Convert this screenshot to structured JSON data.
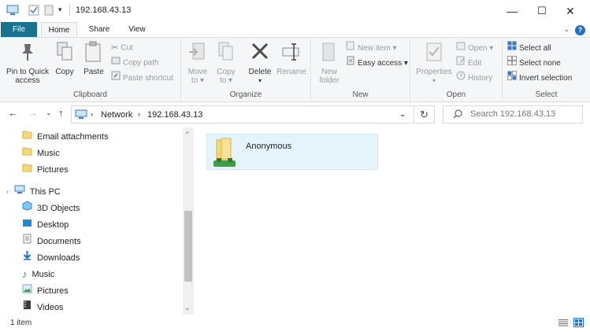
{
  "window": {
    "title": "192.168.43.13",
    "minimize": "—",
    "maximize": "☐",
    "close": "✕"
  },
  "tabs": [
    {
      "label": "File"
    },
    {
      "label": "Home"
    },
    {
      "label": "Share"
    },
    {
      "label": "View"
    }
  ],
  "ribbon": {
    "clipboard": {
      "label": "Clipboard",
      "pin_line1": "Pin to Quick",
      "pin_line2": "access",
      "copy": "Copy",
      "paste": "Paste",
      "cut": "Cut",
      "copy_path": "Copy path",
      "paste_shortcut": "Paste shortcut"
    },
    "organize": {
      "label": "Organize",
      "move_to_1": "Move",
      "move_to_2": "to",
      "copy_to_1": "Copy",
      "copy_to_2": "to",
      "delete": "Delete",
      "rename": "Rename"
    },
    "new": {
      "label": "New",
      "new_folder_1": "New",
      "new_folder_2": "folder",
      "new_item": "New item",
      "easy_access": "Easy access"
    },
    "open": {
      "label": "Open",
      "properties": "Properties",
      "open": "Open",
      "edit": "Edit",
      "history": "History"
    },
    "select": {
      "label": "Select",
      "select_all": "Select all",
      "select_none": "Select none",
      "invert_selection": "Invert selection"
    }
  },
  "address": {
    "crumbs": [
      "Network",
      "192.168.43.13"
    ],
    "search_placeholder": "Search 192.168.43.13"
  },
  "nav": {
    "items": [
      {
        "label": "Email attachments",
        "icon": "folder-icon"
      },
      {
        "label": "Music",
        "icon": "folder-icon"
      },
      {
        "label": "Pictures",
        "icon": "folder-icon"
      },
      {
        "label": "This PC",
        "icon": "computer-icon"
      },
      {
        "label": "3D Objects",
        "icon": "3d-objects-icon"
      },
      {
        "label": "Desktop",
        "icon": "desktop-icon"
      },
      {
        "label": "Documents",
        "icon": "documents-icon"
      },
      {
        "label": "Downloads",
        "icon": "downloads-icon"
      },
      {
        "label": "Music",
        "icon": "music-icon"
      },
      {
        "label": "Pictures",
        "icon": "pictures-icon"
      },
      {
        "label": "Videos",
        "icon": "videos-icon"
      }
    ]
  },
  "content": {
    "items": [
      {
        "name": "Anonymous",
        "icon": "shared-folder-icon"
      }
    ]
  },
  "status": {
    "count": "1 item"
  },
  "colors": {
    "file_tab": "#19728e",
    "selection": "#e5f3fb",
    "folder": "#f8d775",
    "accent": "#1c70c6"
  }
}
